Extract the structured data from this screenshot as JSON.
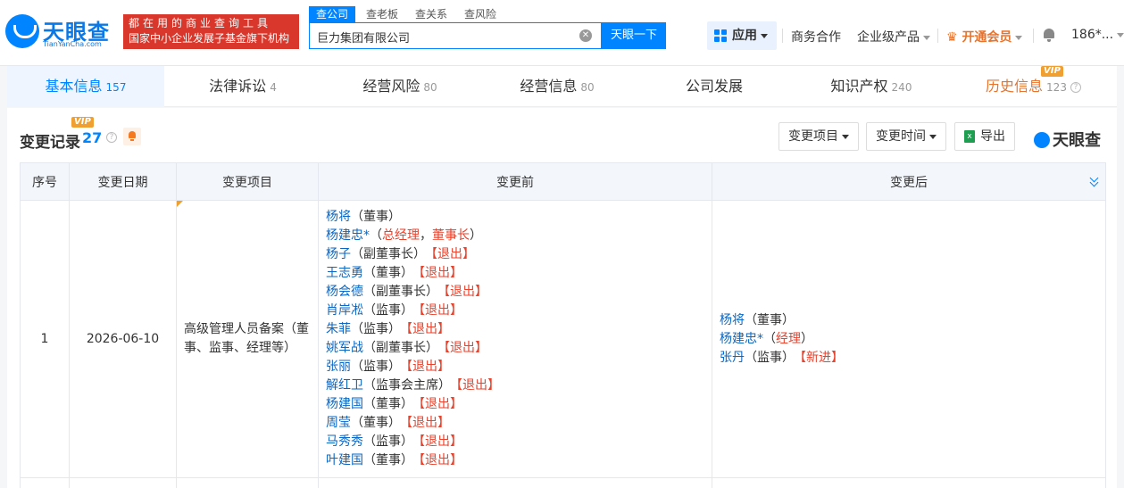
{
  "header": {
    "logo_text": "天眼查",
    "logo_sub": "TianYanCha.com",
    "slogan_line1": "都在用的商业查询工具",
    "slogan_line2": "国家中小企业发展子基金旗下机构",
    "search_tabs": [
      "查公司",
      "查老板",
      "查关系",
      "查风险"
    ],
    "search_value": "巨力集团有限公司",
    "search_button": "天眼一下",
    "apps_label": "应用",
    "nav_business": "商务合作",
    "nav_enterprise": "企业级产品",
    "nav_vip": "开通会员",
    "user": "186*..."
  },
  "tabs": [
    {
      "label": "基本信息",
      "count": "157"
    },
    {
      "label": "法律诉讼",
      "count": "4"
    },
    {
      "label": "经营风险",
      "count": "80"
    },
    {
      "label": "经营信息",
      "count": "80"
    },
    {
      "label": "公司发展",
      "count": ""
    },
    {
      "label": "知识产权",
      "count": "240"
    },
    {
      "label": "历史信息",
      "count": "123"
    }
  ],
  "vip_label": "VIP",
  "section": {
    "title": "变更记录",
    "count": "27",
    "filter_item": "变更项目",
    "filter_time": "变更时间",
    "export": "导出",
    "brand": "天眼查"
  },
  "table": {
    "headers": [
      "序号",
      "变更日期",
      "变更项目",
      "变更前",
      "变更后"
    ],
    "rows": [
      {
        "num": "1",
        "date": "2026-06-10",
        "item": "高级管理人员备案（董事、监事、经理等）",
        "before": [
          {
            "name": "杨将",
            "role": "（董事）",
            "tag": ""
          },
          {
            "name": "杨建忠*",
            "role": "（总经理，董事长）",
            "tag": ""
          },
          {
            "name": "杨子",
            "role": "（副董事长）",
            "tag": "【退出】"
          },
          {
            "name": "王志勇",
            "role": "（董事）",
            "tag": "【退出】"
          },
          {
            "name": "杨会德",
            "role": "（副董事长）",
            "tag": "【退出】"
          },
          {
            "name": "肖岸凇",
            "role": "（监事）",
            "tag": "【退出】"
          },
          {
            "name": "朱菲",
            "role": "（监事）",
            "tag": "【退出】"
          },
          {
            "name": "姚军战",
            "role": "（副董事长）",
            "tag": "【退出】"
          },
          {
            "name": "张丽",
            "role": "（监事）",
            "tag": "【退出】"
          },
          {
            "name": "解红卫",
            "role": "（监事会主席）",
            "tag": "【退出】"
          },
          {
            "name": "杨建国",
            "role": "（董事）",
            "tag": "【退出】"
          },
          {
            "name": "周莹",
            "role": "（董事）",
            "tag": "【退出】"
          },
          {
            "name": "马秀秀",
            "role": "（监事）",
            "tag": "【退出】"
          },
          {
            "name": "叶建国",
            "role": "（董事）",
            "tag": "【退出】"
          }
        ],
        "after": [
          {
            "name": "杨将",
            "role": "（董事）",
            "tag": ""
          },
          {
            "name": "杨建忠*",
            "role": "（经理）",
            "tag": ""
          },
          {
            "name": "张丹",
            "role": "（监事）",
            "tag": "【新进】"
          }
        ]
      }
    ]
  },
  "colors": {
    "accent": "#0084ff",
    "red": "#e8412c",
    "vip": "#f0a030"
  }
}
